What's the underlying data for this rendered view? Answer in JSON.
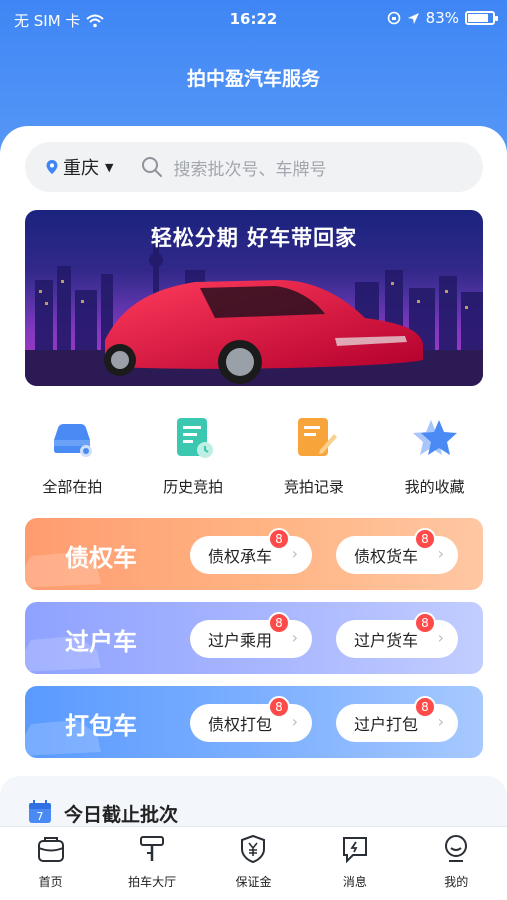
{
  "status_bar": {
    "carrier": "无 SIM 卡",
    "time": "16:22",
    "battery": "83%"
  },
  "nav": {
    "title": "拍中盈汽车服务"
  },
  "search": {
    "city": "重庆",
    "placeholder": "搜索批次号、车牌号"
  },
  "banner": {
    "title": "轻松分期 好车带回家"
  },
  "quick_actions": [
    {
      "label": "全部在拍",
      "icon": "car-icon"
    },
    {
      "label": "历史竞拍",
      "icon": "history-doc-icon"
    },
    {
      "label": "竞拍记录",
      "icon": "record-edit-icon"
    },
    {
      "label": "我的收藏",
      "icon": "star-icon"
    }
  ],
  "categories": [
    {
      "title": "债权车",
      "buttons": [
        {
          "label": "债权承车",
          "badge": "8"
        },
        {
          "label": "债权货车",
          "badge": "8"
        }
      ]
    },
    {
      "title": "过户车",
      "buttons": [
        {
          "label": "过户乘用",
          "badge": "8"
        },
        {
          "label": "过户货车",
          "badge": "8"
        }
      ]
    },
    {
      "title": "打包车",
      "buttons": [
        {
          "label": "债权打包",
          "badge": "8"
        },
        {
          "label": "过户打包",
          "badge": "8"
        }
      ]
    }
  ],
  "today": {
    "title": "今日截止批次",
    "calendar_day": "7"
  },
  "tabbar": [
    {
      "label": "首页",
      "icon": "home-bag-icon"
    },
    {
      "label": "拍车大厅",
      "icon": "gavel-icon"
    },
    {
      "label": "保证金",
      "icon": "shield-yen-icon"
    },
    {
      "label": "消息",
      "icon": "message-icon"
    },
    {
      "label": "我的",
      "icon": "profile-icon"
    }
  ],
  "colors": {
    "primary": "#3f86f5",
    "debt": "#ff9c6f",
    "transfer": "#8fa2ff",
    "pack": "#5a9aff",
    "badge": "#ff4a4a"
  }
}
